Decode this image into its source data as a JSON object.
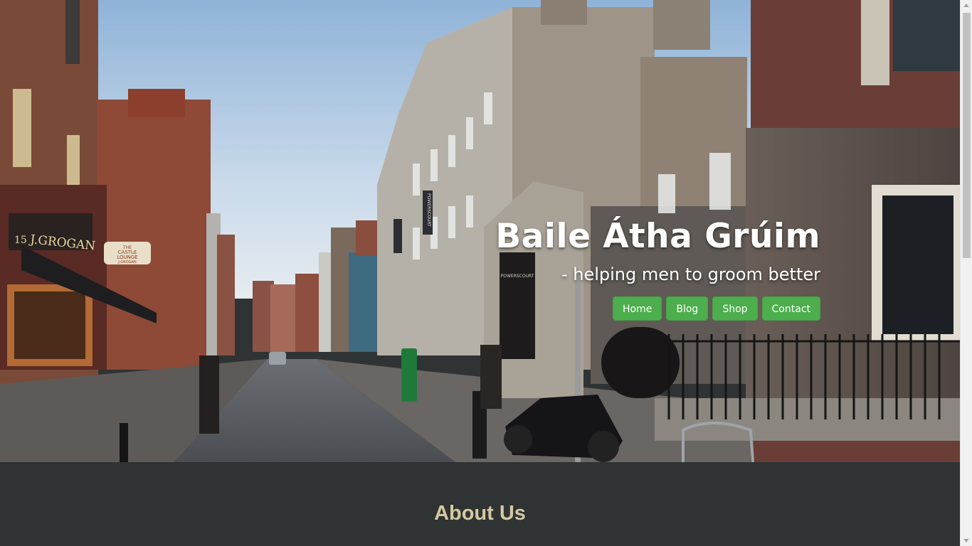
{
  "hero": {
    "title": "Baile Átha Grúim",
    "tagline": "- helping men to groom better",
    "image": "dublin-street-photo"
  },
  "nav": {
    "items": [
      {
        "label": "Home"
      },
      {
        "label": "Blog"
      },
      {
        "label": "Shop"
      },
      {
        "label": "Contact"
      }
    ],
    "color": "#4cae4c"
  },
  "signs": {
    "pub_name": "J.GROGAN",
    "pub_number": "15",
    "lounge_line1": "THE",
    "lounge_line2": "CASTLE",
    "lounge_line3": "LOUNGE",
    "lounge_line4": "J.GROGAN",
    "powerscourt_banner": "POWERSCOURT",
    "powerscourt_arch": "POWERSCOURT"
  },
  "about": {
    "heading": "About Us"
  },
  "colors": {
    "section_bg": "#2f3334",
    "about_heading": "#d3c9a1"
  }
}
